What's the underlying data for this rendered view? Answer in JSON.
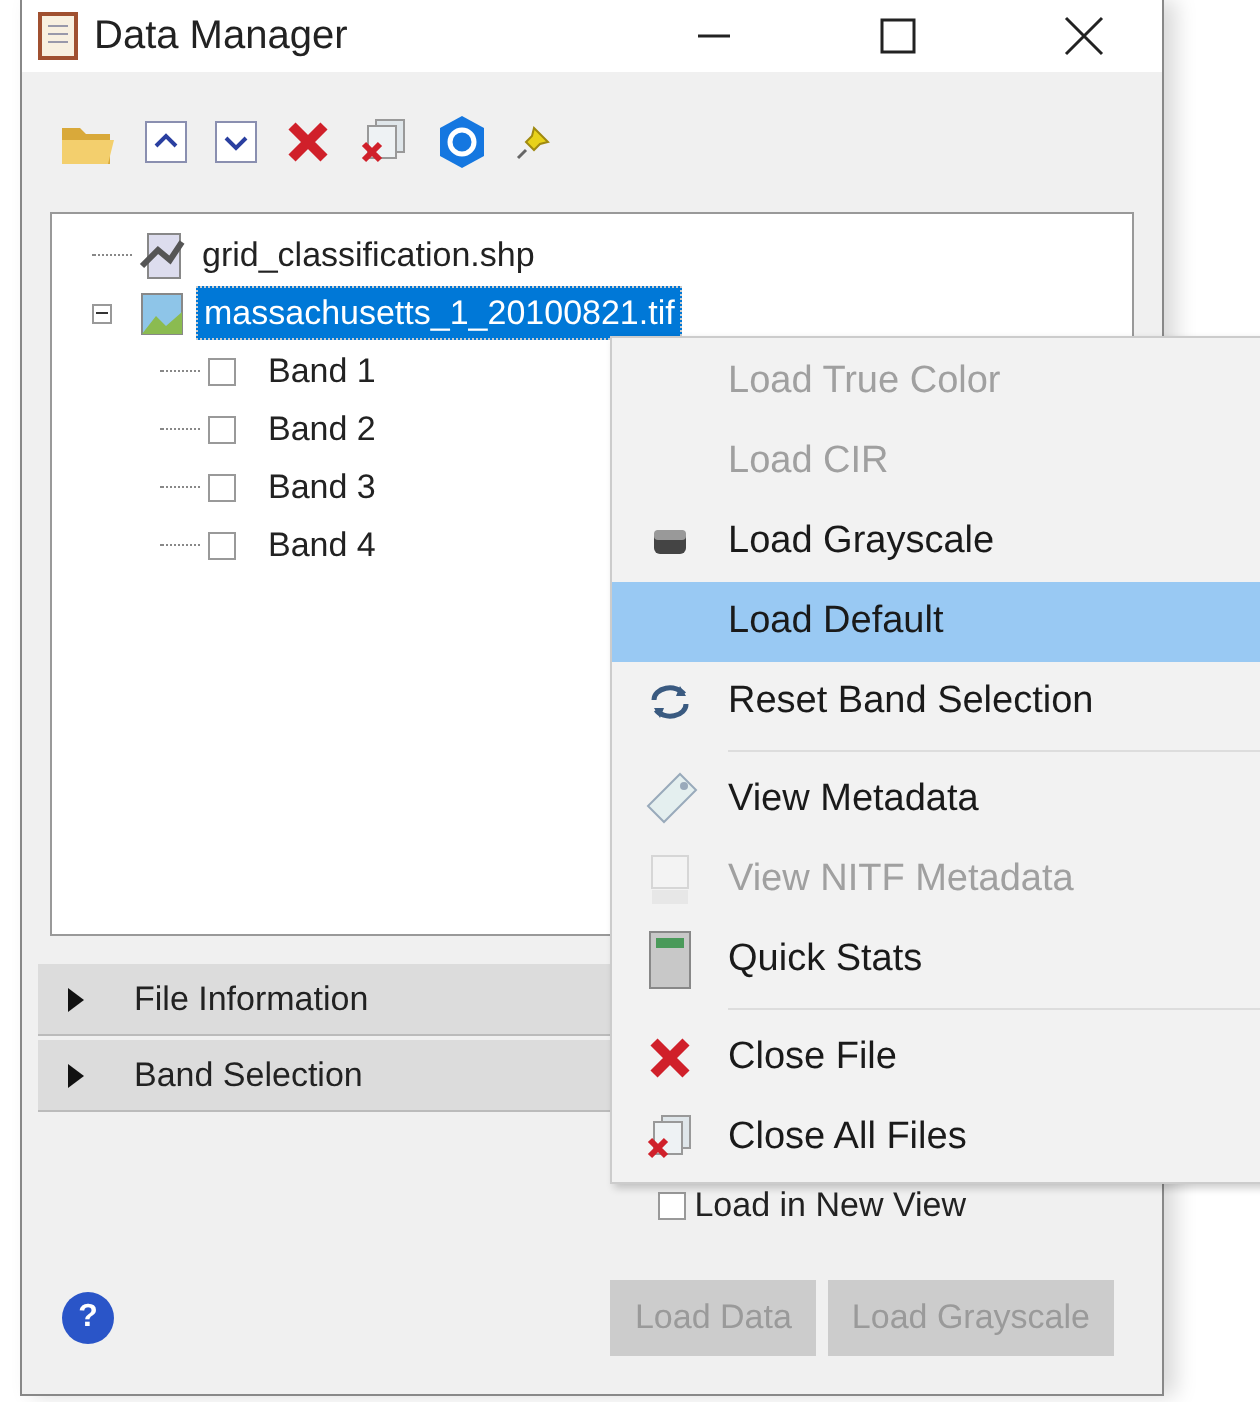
{
  "window": {
    "title": "Data Manager"
  },
  "toolbar": [
    {
      "kind": "open"
    },
    {
      "kind": "up"
    },
    {
      "kind": "down"
    },
    {
      "kind": "close"
    },
    {
      "kind": "closeall"
    },
    {
      "kind": "hex"
    },
    {
      "kind": "pin"
    }
  ],
  "tree": [
    {
      "label": "grid_classification.shp",
      "kind": "vector",
      "selected": false
    },
    {
      "label": "massachusetts_1_20100821.tif",
      "kind": "raster",
      "selected": true,
      "expanded": true,
      "children": [
        {
          "label": "Band 1",
          "checked": false
        },
        {
          "label": "Band 2",
          "checked": false
        },
        {
          "label": "Band 3",
          "checked": false
        },
        {
          "label": "Band 4",
          "checked": false
        }
      ]
    }
  ],
  "sections": [
    {
      "label": "File Information",
      "expanded": false
    },
    {
      "label": "Band Selection",
      "expanded": false
    }
  ],
  "help": {
    "label": "?"
  },
  "load_in_new_view": {
    "label": "Load in New View",
    "checked": false
  },
  "buttons": [
    {
      "label": "Load Data",
      "disabled": true
    },
    {
      "label": "Load Grayscale",
      "disabled": true
    }
  ],
  "context_menu": [
    [
      {
        "label": "Load True Color",
        "disabled": true,
        "selected": false
      },
      {
        "label": "Load CIR",
        "disabled": true,
        "selected": false
      },
      {
        "label": "Load Grayscale",
        "disabled": false,
        "selected": false,
        "kind": "gray"
      },
      {
        "label": "Load Default",
        "disabled": false,
        "selected": true
      },
      {
        "label": "Reset Band Selection",
        "disabled": false,
        "selected": false,
        "kind": "refresh"
      }
    ],
    [
      {
        "label": "View Metadata",
        "disabled": false,
        "selected": false,
        "kind": "tag"
      },
      {
        "label": "View NITF Metadata",
        "disabled": true,
        "selected": false,
        "kind": "nitf"
      },
      {
        "label": "Quick Stats",
        "disabled": false,
        "selected": false,
        "kind": "calc"
      }
    ],
    [
      {
        "label": "Close File",
        "disabled": false,
        "selected": false,
        "kind": "close"
      },
      {
        "label": "Close All Files",
        "disabled": false,
        "selected": false,
        "kind": "closeall"
      }
    ]
  ]
}
